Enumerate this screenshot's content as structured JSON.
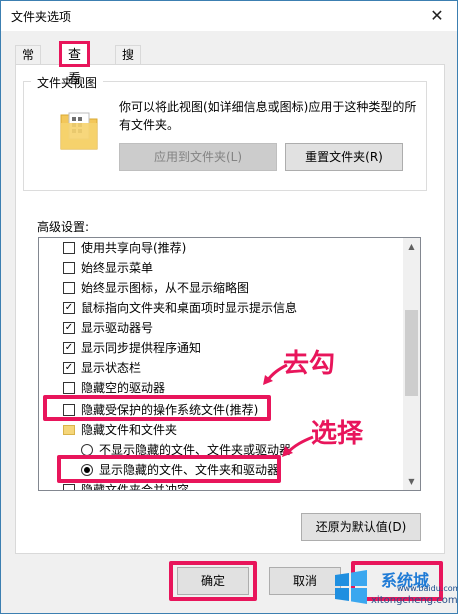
{
  "window": {
    "title": "文件夹选项",
    "close_glyph": "✕"
  },
  "tabs": [
    {
      "label": "常规"
    },
    {
      "label": "查看"
    },
    {
      "label": "搜索"
    }
  ],
  "folder_view": {
    "legend": "文件夹视图",
    "description": "你可以将此视图(如详细信息或图标)应用于这种类型的所有文件夹。",
    "apply_button": "应用到文件夹(L)",
    "reset_button": "重置文件夹(R)"
  },
  "advanced": {
    "label": "高级设置:",
    "items": [
      {
        "text": "使用共享向导(推荐)",
        "type": "checkbox",
        "checked": false
      },
      {
        "text": "始终显示菜单",
        "type": "checkbox",
        "checked": false
      },
      {
        "text": "始终显示图标，从不显示缩略图",
        "type": "checkbox",
        "checked": false
      },
      {
        "text": "鼠标指向文件夹和桌面项时显示提示信息",
        "type": "checkbox",
        "checked": true
      },
      {
        "text": "显示驱动器号",
        "type": "checkbox",
        "checked": true
      },
      {
        "text": "显示同步提供程序通知",
        "type": "checkbox",
        "checked": true
      },
      {
        "text": "显示状态栏",
        "type": "checkbox",
        "checked": true
      },
      {
        "text": "隐藏空的驱动器",
        "type": "checkbox",
        "checked": false
      },
      {
        "text": "隐藏受保护的操作系统文件(推荐)",
        "type": "checkbox",
        "checked": false
      },
      {
        "text": "隐藏文件和文件夹",
        "type": "folder"
      },
      {
        "text": "不显示隐藏的文件、文件夹或驱动器",
        "type": "radio",
        "checked": false
      },
      {
        "text": "显示隐藏的文件、文件夹和驱动器",
        "type": "radio",
        "checked": true
      },
      {
        "text": "隐藏文件夹合并冲突",
        "type": "checkbox",
        "checked": false
      }
    ]
  },
  "restore_button": "还原为默认值(D)",
  "ok_button": "确定",
  "cancel_button": "取消",
  "annotations": {
    "uncheck": "去勾",
    "select": "选择"
  },
  "watermark": {
    "brand": "系统城",
    "sub": "www.baidu.com",
    "url": "xitongcheng.com"
  },
  "colors": {
    "highlight": "#e8155b",
    "check_mark": "✓"
  }
}
